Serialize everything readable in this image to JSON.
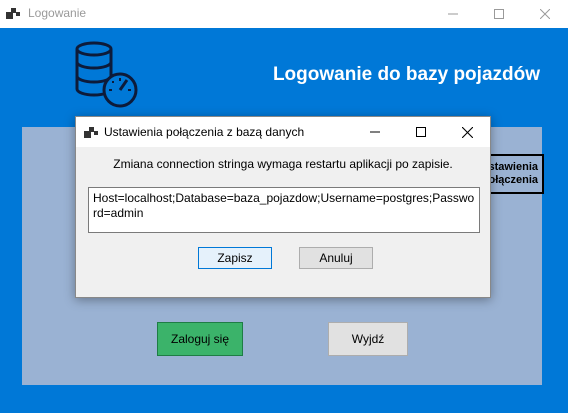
{
  "window": {
    "title": "Logowanie",
    "icon": "app-window-icon",
    "controls": [
      "minimize-icon",
      "maximize-icon",
      "close-icon"
    ]
  },
  "main": {
    "header_title": "Logowanie do bazy pojazdów",
    "logo_icon": "database-gauge-icon",
    "settings_button_label": "Ustawienia\npołączenia",
    "login_button_label": "Zaloguj się",
    "exit_button_label": "Wyjdź",
    "colors": {
      "window_bg": "#0078d7",
      "panel_bg": "#9ab2d3",
      "login_button": "#3bb36a"
    }
  },
  "dialog": {
    "title": "Ustawienia połączenia z bazą danych",
    "icon": "app-window-icon",
    "message": "Zmiana connection stringa wymaga restartu aplikacji po zapisie.",
    "connection_string": "Host=localhost;Database=baza_pojazdow;Username=postgres;Password=admin",
    "save_label": "Zapisz",
    "cancel_label": "Anuluj"
  }
}
